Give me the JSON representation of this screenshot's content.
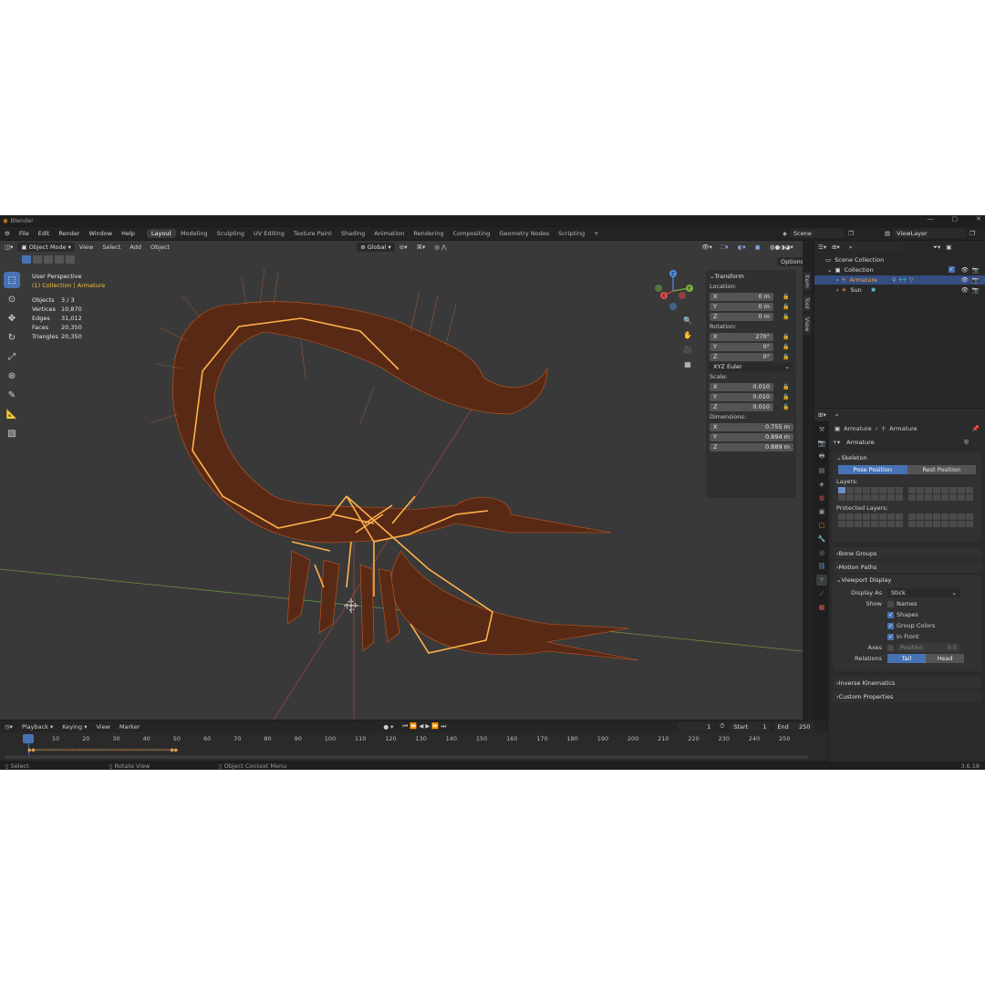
{
  "window": {
    "title": "Blender"
  },
  "menu": {
    "items": [
      "File",
      "Edit",
      "Render",
      "Window",
      "Help"
    ],
    "workspaces": [
      "Layout",
      "Modeling",
      "Sculpting",
      "UV Editing",
      "Texture Paint",
      "Shading",
      "Animation",
      "Rendering",
      "Compositing",
      "Geometry Nodes",
      "Scripting"
    ],
    "active_workspace": "Layout",
    "add_tab": "+",
    "scene": "Scene",
    "view_layer": "ViewLayer"
  },
  "viewport": {
    "mode": "Object Mode",
    "menus": [
      "View",
      "Select",
      "Add",
      "Object"
    ],
    "orientation": "Global",
    "options": "Options",
    "view_name": "User Perspective",
    "collection_info": "(1) Collection | Armature",
    "stats": [
      {
        "label": "Objects",
        "value": "3 / 3"
      },
      {
        "label": "Vertices",
        "value": "10,870"
      },
      {
        "label": "Edges",
        "value": "31,012"
      },
      {
        "label": "Faces",
        "value": "20,350"
      },
      {
        "label": "Triangles",
        "value": "20,350"
      }
    ],
    "gizmo": {
      "x": "X",
      "y": "Y",
      "z": "Z"
    }
  },
  "transform": {
    "title": "Transform",
    "location_label": "Location:",
    "location": [
      {
        "axis": "X",
        "value": "0 m"
      },
      {
        "axis": "Y",
        "value": "0 m"
      },
      {
        "axis": "Z",
        "value": "0 m"
      }
    ],
    "rotation_label": "Rotation:",
    "rotation": [
      {
        "axis": "X",
        "value": "270°"
      },
      {
        "axis": "Y",
        "value": "0°"
      },
      {
        "axis": "Z",
        "value": "0°"
      }
    ],
    "rotation_mode": "XYZ Euler",
    "scale_label": "Scale:",
    "scale": [
      {
        "axis": "X",
        "value": "0.010"
      },
      {
        "axis": "Y",
        "value": "0.010"
      },
      {
        "axis": "Z",
        "value": "0.010"
      }
    ],
    "dimensions_label": "Dimensions:",
    "dimensions": [
      {
        "axis": "X",
        "value": "0.755 m"
      },
      {
        "axis": "Y",
        "value": "0.894 m"
      },
      {
        "axis": "Z",
        "value": "0.889 m"
      }
    ]
  },
  "sidetabs": [
    "Item",
    "Tool",
    "View"
  ],
  "outliner": {
    "root": "Scene Collection",
    "collection": "Collection",
    "items": [
      "Armature",
      "Sun"
    ]
  },
  "properties": {
    "breadcrumb_object": "Armature",
    "breadcrumb_data": "Armature",
    "data_name": "Armature",
    "skeleton": {
      "title": "Skeleton",
      "pose_position": "Pose Position",
      "rest_position": "Rest Position",
      "layers_label": "Layers:",
      "protected_layers_label": "Protected Layers:"
    },
    "bone_groups": "Bone Groups",
    "motion_paths": "Motion Paths",
    "viewport_display": {
      "title": "Viewport Display",
      "display_as_label": "Display As",
      "display_as_value": "Stick",
      "show_label": "Show",
      "show_items": [
        "Names",
        "Shapes",
        "Group Colors",
        "In Front"
      ],
      "axes_label": "Axes",
      "position_label": "Position",
      "position_value": "0.0",
      "relations_label": "Relations",
      "tail": "Tail",
      "head": "Head"
    },
    "inverse_kinematics": "Inverse Kinematics",
    "custom_properties": "Custom Properties"
  },
  "timeline": {
    "menus": [
      "Playback",
      "Keying",
      "View",
      "Marker"
    ],
    "current_frame": "1",
    "start_label": "Start",
    "start_value": "1",
    "end_label": "End",
    "end_value": "250",
    "ruler": [
      "1",
      "10",
      "20",
      "30",
      "40",
      "50",
      "60",
      "70",
      "80",
      "90",
      "100",
      "110",
      "120",
      "130",
      "140",
      "150",
      "160",
      "170",
      "180",
      "190",
      "200",
      "210",
      "220",
      "230",
      "240",
      "250"
    ]
  },
  "statusbar": {
    "left": "Select",
    "mid": "Rotate View",
    "right": "Object Context Menu",
    "version": "3.6.18"
  },
  "colors": {
    "accent": "#4772b3",
    "wire": "#d45a1f",
    "bones": "#ffb24a",
    "active_text": "#f0c040"
  }
}
